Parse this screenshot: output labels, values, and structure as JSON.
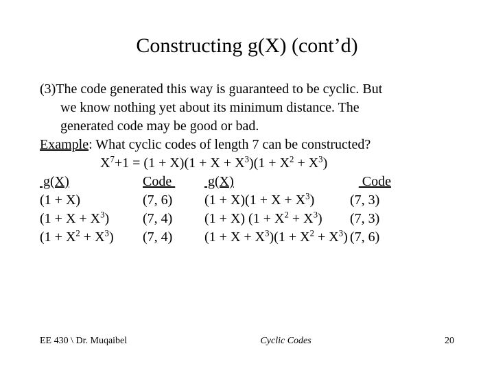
{
  "title": "Constructing g(X) (cont’d)",
  "para3_lead": "(3)The code generated this way is guaranteed to be cyclic. But",
  "para3_cont1": "we know nothing yet about its minimum distance. The",
  "para3_cont2": "generated code may be good or bad.",
  "example_label": "Example",
  "example_rest": ": What cyclic codes of length 7 can be constructed?",
  "factorization_html": "X<sup>7</sup>+1 = (1 + X)(1 + X + X<sup>3</sup>)(1 + X<sup>2</sup> + X<sup>3</sup>)",
  "headers": {
    "g1": " g(X)",
    "code1": "Code ",
    "g2": " g(X)",
    "code2": " Code"
  },
  "rows": [
    {
      "g1_html": "(1 + X)",
      "c1": "(7, 6)",
      "g2_html": "(1 + X)(1 + X + X<sup>3</sup>)",
      "c2": "(7, 3)"
    },
    {
      "g1_html": "(1 + X + X<sup>3</sup>)",
      "c1": "(7, 4)",
      "g2_html": "(1 + X) (1 + X<sup>2</sup> + X<sup>3</sup>)",
      "c2": "(7, 3)"
    },
    {
      "g1_html": "(1 + X<sup>2</sup> + X<sup>3</sup>)",
      "c1": "(7, 4)",
      "g2_html": "(1 + X + X<sup>3</sup>)(1 + X<sup>2</sup> + X<sup>3</sup>)",
      "c2": "(7, 6)"
    }
  ],
  "footer": {
    "left": "EE 430 \\ Dr. Muqaibel",
    "center": "Cyclic Codes",
    "right": "20"
  }
}
